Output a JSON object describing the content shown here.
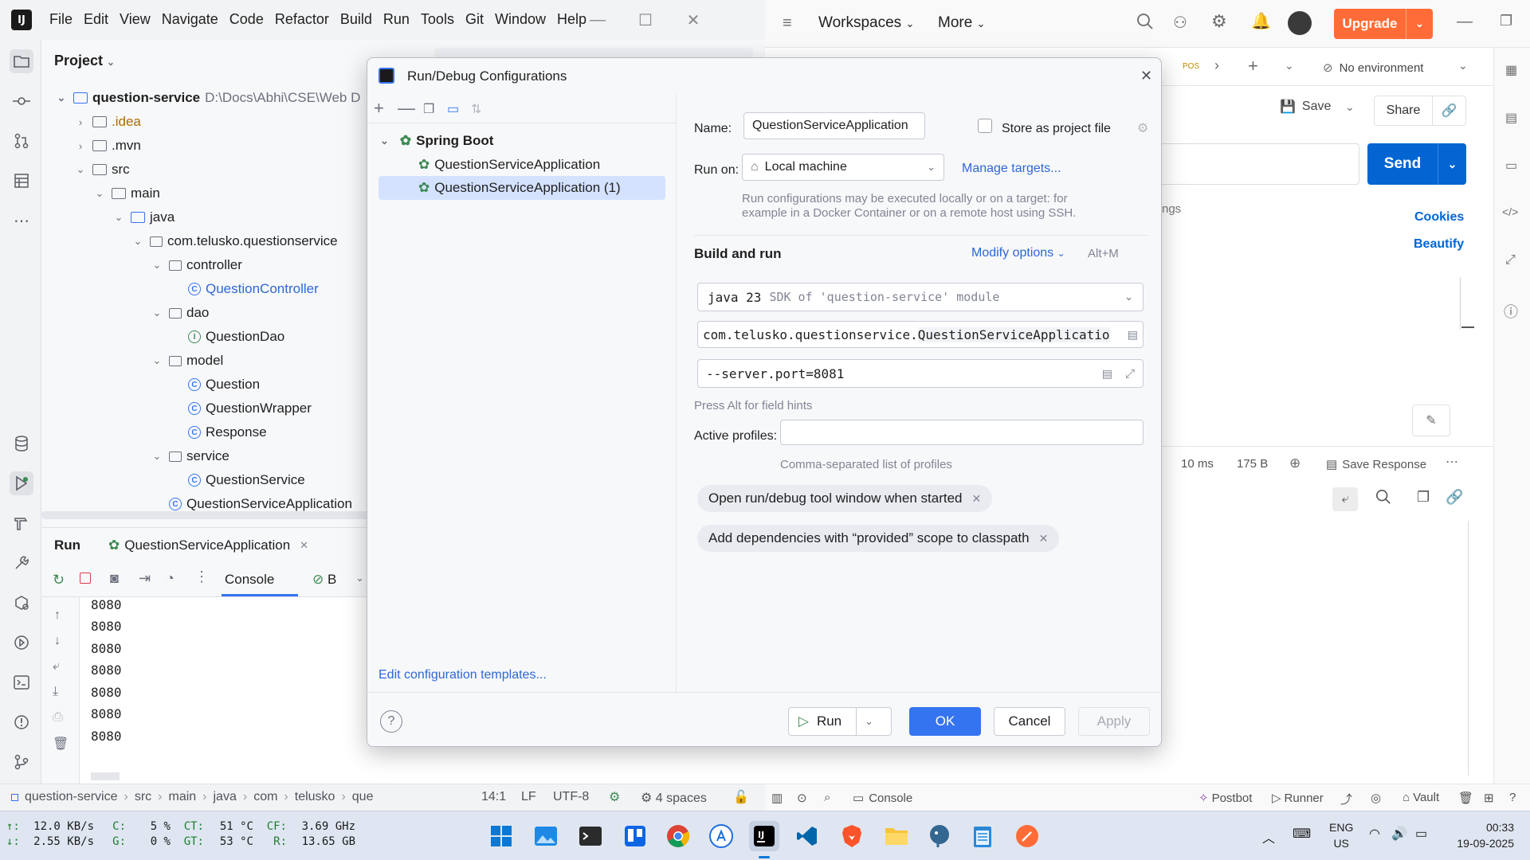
{
  "ide": {
    "menu": [
      "File",
      "Edit",
      "View",
      "Navigate",
      "Code",
      "Refactor",
      "Build",
      "Run",
      "Tools",
      "Git",
      "Window",
      "Help"
    ],
    "project_label": "Project",
    "tree": [
      {
        "label": "question-service",
        "extra": "D:\\Docs\\Abhi\\CSE\\Web D",
        "kind": "root"
      },
      {
        "label": ".idea",
        "kind": "folder"
      },
      {
        "label": ".mvn",
        "kind": "folder"
      },
      {
        "label": "src",
        "kind": "folder"
      },
      {
        "label": "main",
        "kind": "folder"
      },
      {
        "label": "java",
        "kind": "folder"
      },
      {
        "label": "com.telusko.questionservice",
        "kind": "package"
      },
      {
        "label": "controller",
        "kind": "package"
      },
      {
        "label": "QuestionController",
        "kind": "class"
      },
      {
        "label": "dao",
        "kind": "package"
      },
      {
        "label": "QuestionDao",
        "kind": "interface"
      },
      {
        "label": "model",
        "kind": "package"
      },
      {
        "label": "Question",
        "kind": "class"
      },
      {
        "label": "QuestionWrapper",
        "kind": "class"
      },
      {
        "label": "Response",
        "kind": "class"
      },
      {
        "label": "service",
        "kind": "package"
      },
      {
        "label": "QuestionService",
        "kind": "class"
      },
      {
        "label": "QuestionServiceApplication",
        "kind": "springclass"
      }
    ],
    "run_tab": "Run",
    "run_config_tab": "QuestionServiceApplication",
    "console_tab": "Console",
    "console_tab2": "B",
    "console_lines": [
      "8080",
      "8080",
      "8080",
      "8080",
      "8080",
      "8080",
      "8080"
    ],
    "breadcrumb": [
      "question-service",
      "src",
      "main",
      "java",
      "com",
      "telusko",
      "que"
    ],
    "status": {
      "position": "14:1",
      "line_sep": "LF",
      "encoding": "UTF-8",
      "indent": "4 spaces"
    }
  },
  "dialog": {
    "title": "Run/Debug Configurations",
    "tree_group": "Spring Boot",
    "configs": [
      "QuestionServiceApplication",
      "QuestionServiceApplication (1)"
    ],
    "edit_templates": "Edit configuration templates...",
    "name_label": "Name:",
    "name_value": "QuestionServiceApplication",
    "store_label": "Store as project file",
    "run_on_label": "Run on:",
    "run_on_value": "Local machine",
    "manage_targets": "Manage targets...",
    "run_on_hint_1": "Run configurations may be executed locally or on a target: for",
    "run_on_hint_2": "example in a Docker Container or on a remote host using SSH.",
    "build_run": "Build and run",
    "modify_options": "Modify options",
    "modify_shortcut": "Alt+M",
    "jdk_name": "java 23",
    "jdk_desc": "SDK of 'question-service' module",
    "main_class_pkg": "com.telusko.questionservice.",
    "main_class_name": "QuestionServiceApplicatio",
    "program_args": "--server.port=8081",
    "field_hint": "Press Alt for field hints",
    "active_profiles_label": "Active profiles:",
    "active_profiles_value": "",
    "profiles_hint": "Comma-separated list of profiles",
    "chip1": "Open run/debug tool window when started",
    "chip2": "Add dependencies with “provided” scope to classpath",
    "run_btn": "Run",
    "ok_btn": "OK",
    "cancel_btn": "Cancel",
    "apply_btn": "Apply"
  },
  "postman": {
    "workspaces": "Workspaces",
    "more": "More",
    "upgrade": "Upgrade",
    "tab_method": "POS",
    "no_env": "No environment",
    "save": "Save",
    "share": "Share",
    "send": "Send",
    "settings_partial": "ngs",
    "cookies": "Cookies",
    "beautify": "Beautify",
    "resp_time": "10 ms",
    "resp_size": "175 B",
    "save_response": "Save Response",
    "console": "Console",
    "postbot": "Postbot",
    "runner": "Runner",
    "vault": "Vault"
  },
  "taskbar": {
    "net_up_label": "↑:",
    "net_up": "12.0 KB/s",
    "net_down_label": "↓:",
    "net_down": "2.55 KB/s",
    "cpu_label": "C:",
    "cpu": "5 %",
    "gpu_label": "G:",
    "gpu": "0 %",
    "ct_label": "CT:",
    "ct": "51 °C",
    "gt_label": "GT:",
    "gt": "53 °C",
    "cf_label": "CF:",
    "cf": "3.69 GHz",
    "r_label": "R:",
    "r": "13.65 GB",
    "lang1": "ENG",
    "lang2": "US",
    "time": "00:33",
    "date": "19-09-2025"
  },
  "colors": {
    "accent_blue": "#3574f0",
    "ok_blue": "#3574f0",
    "send_blue": "#0265d2",
    "upgrade_orange": "#ff6c37",
    "selection": "#d4e2ff"
  }
}
